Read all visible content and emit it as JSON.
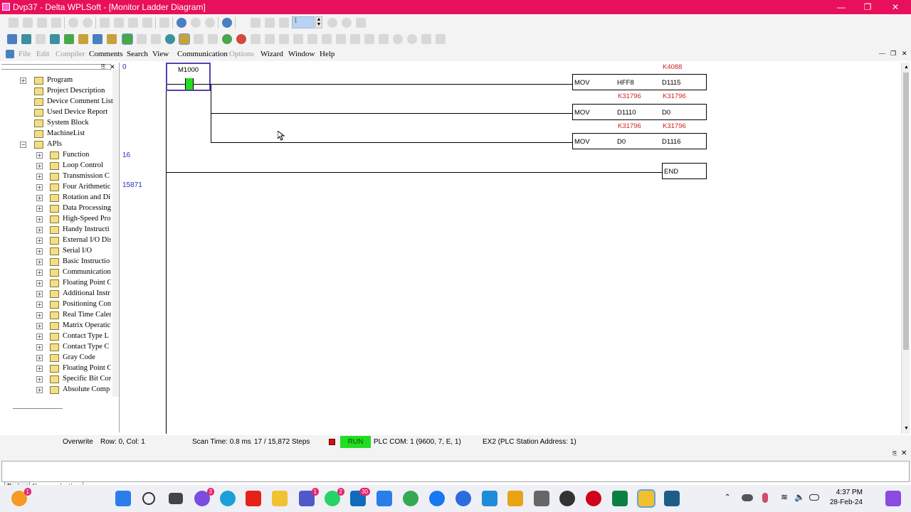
{
  "window": {
    "title": "Dvp37 - Delta WPLSoft - [Monitor Ladder Diagram]",
    "step_field": "1"
  },
  "menu": {
    "items": [
      {
        "label": "File",
        "enabled": false
      },
      {
        "label": "Edit",
        "enabled": false
      },
      {
        "label": "Compiler",
        "enabled": false
      },
      {
        "label": "Comments",
        "enabled": true
      },
      {
        "label": "Search",
        "enabled": true
      },
      {
        "label": "View",
        "enabled": true
      },
      {
        "label": "Communication",
        "enabled": true
      },
      {
        "label": "Options",
        "enabled": false
      },
      {
        "label": "Wizard",
        "enabled": true
      },
      {
        "label": "Window",
        "enabled": true
      },
      {
        "label": "Help",
        "enabled": true
      }
    ]
  },
  "tree": {
    "root_items": [
      "Program",
      "Project Description",
      "Device Comment List",
      "Used Device Report",
      "System Block",
      "MachineList",
      "APIs"
    ],
    "api_items": [
      "Function",
      "Loop Control",
      "Transmission C",
      "Four Arithmetic",
      "Rotation and Di",
      "Data Processing",
      "High-Speed Pro",
      "Handy Instructi",
      "External I/O Dis",
      "Serial I/O",
      "Basic Instructio",
      "Communication",
      "Floating Point C",
      "Additional Instr",
      "Positioning Con",
      "Real Time Caler",
      "Matrix Operatic",
      "Contact Type L",
      "Contact Type C",
      "Gray Code",
      "Floating Point C",
      "Specific Bit Cor",
      "Absolute Comp"
    ]
  },
  "tabs": [
    "Project",
    "Communication"
  ],
  "ladder": {
    "rung_numbers": [
      "0",
      "16",
      "15871"
    ],
    "contact": "M1000",
    "instructions": [
      {
        "op": "MOV",
        "src": "HFF8",
        "dst": "D1115",
        "mon_src": "",
        "mon_dst": "K4088"
      },
      {
        "op": "MOV",
        "src": "D1110",
        "dst": "D0",
        "mon_src": "K31796",
        "mon_dst": "K31796"
      },
      {
        "op": "MOV",
        "src": "D0",
        "dst": "D1116",
        "mon_src": "K31796",
        "mon_dst": "K31796"
      }
    ],
    "end_label": "END"
  },
  "status": {
    "mode": "Overwrite",
    "position": "Row: 0, Col: 1",
    "scan_time": "Scan Time: 0.8 ms",
    "steps": "17 / 15,872 Steps",
    "run": "RUN",
    "plc_com": "PLC COM: 1 (9600, 7, E, 1)",
    "station": "EX2 (PLC Station Address: 1)"
  },
  "taskbar": {
    "time": "4:37 PM",
    "date": "28-Feb-24",
    "badges": {
      "messenger": "3",
      "teams": "1",
      "whatsapp": "2",
      "outlook": "30",
      "widgets": "1"
    }
  },
  "colors": {
    "titlebar": "#e8105a",
    "run_badge": "#22dd22",
    "monitor_value": "#d02020",
    "rung_number": "#2a2ac8"
  }
}
